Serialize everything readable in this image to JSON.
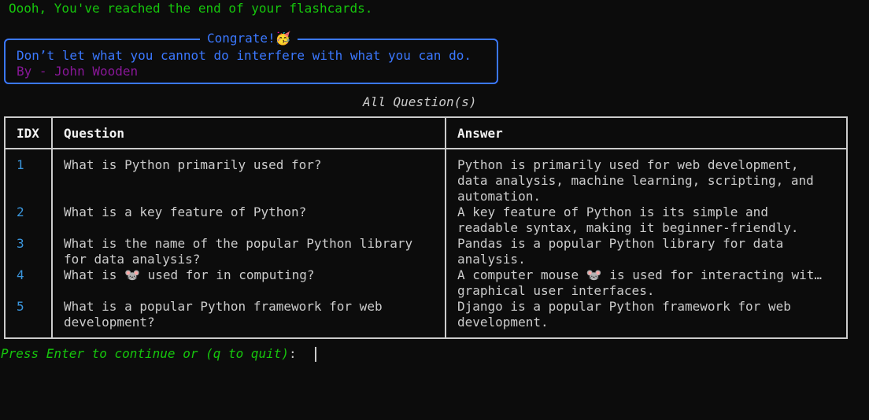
{
  "status_line": "Oooh, You've reached the end of your flashcards.",
  "panel": {
    "title": "Congrate!",
    "title_emoji": "🥳",
    "quote": "Don’t let what you cannot do interfere with what you can do.",
    "author": "By - John Wooden"
  },
  "table": {
    "title": "All Question(s)",
    "headers": {
      "idx": "IDX",
      "question": "Question",
      "answer": "Answer"
    },
    "rows": [
      {
        "idx": "1",
        "question": [
          "What is Python primarily used for?"
        ],
        "answer": [
          "Python is primarily used for web development,",
          "data analysis, machine learning, scripting, and",
          "automation."
        ]
      },
      {
        "idx": "2",
        "question": [
          "What is a key feature of Python?"
        ],
        "answer": [
          "A key feature of Python is its simple and",
          "readable syntax, making it beginner-friendly."
        ]
      },
      {
        "idx": "3",
        "question": [
          "What is the name of the popular Python library",
          "for data analysis?"
        ],
        "answer": [
          "Pandas is a popular Python library for data",
          "analysis."
        ]
      },
      {
        "idx": "4",
        "question": [
          "What is 🐭 used for in computing?"
        ],
        "answer": [
          "A computer mouse 🐭 is used for interacting wit…",
          "graphical user interfaces."
        ]
      },
      {
        "idx": "5",
        "question": [
          "What is a popular Python framework for web",
          "development?"
        ],
        "answer": [
          "Django is a popular Python framework for web",
          "development."
        ]
      }
    ]
  },
  "prompt": {
    "text": "Press Enter to continue or (q to quit)",
    "colon": ": "
  },
  "colors": {
    "background": "#0c0c0c",
    "green": "#16c60c",
    "blue": "#3b78ff",
    "purple": "#881798",
    "index_blue": "#3a96dd",
    "text": "#cccccc"
  }
}
